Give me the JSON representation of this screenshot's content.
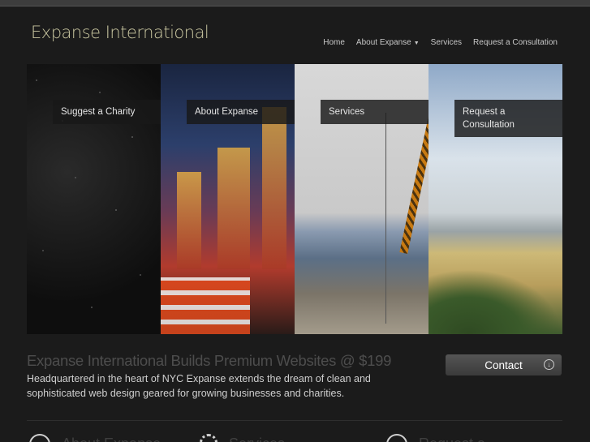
{
  "brand": "Expanse International",
  "nav": {
    "home": "Home",
    "about": "About Expanse",
    "services": "Services",
    "consultation": "Request a Consultation"
  },
  "panels": [
    {
      "label": "Suggest a Charity"
    },
    {
      "label": "About Expanse"
    },
    {
      "label": "Services"
    },
    {
      "label": "Request a Consultation"
    }
  ],
  "intro": {
    "headline": "Expanse International Builds Premium Websites @ $199",
    "description": "Headquartered in the heart of NYC Expanse extends the dream of clean and sophisticated web design geared for growing businesses and charities."
  },
  "contact": {
    "label": "Contact",
    "icon": "arrow-down-circle-icon"
  },
  "bottom": {
    "about": "About Expanse",
    "services": "Services",
    "request": "Request a"
  }
}
